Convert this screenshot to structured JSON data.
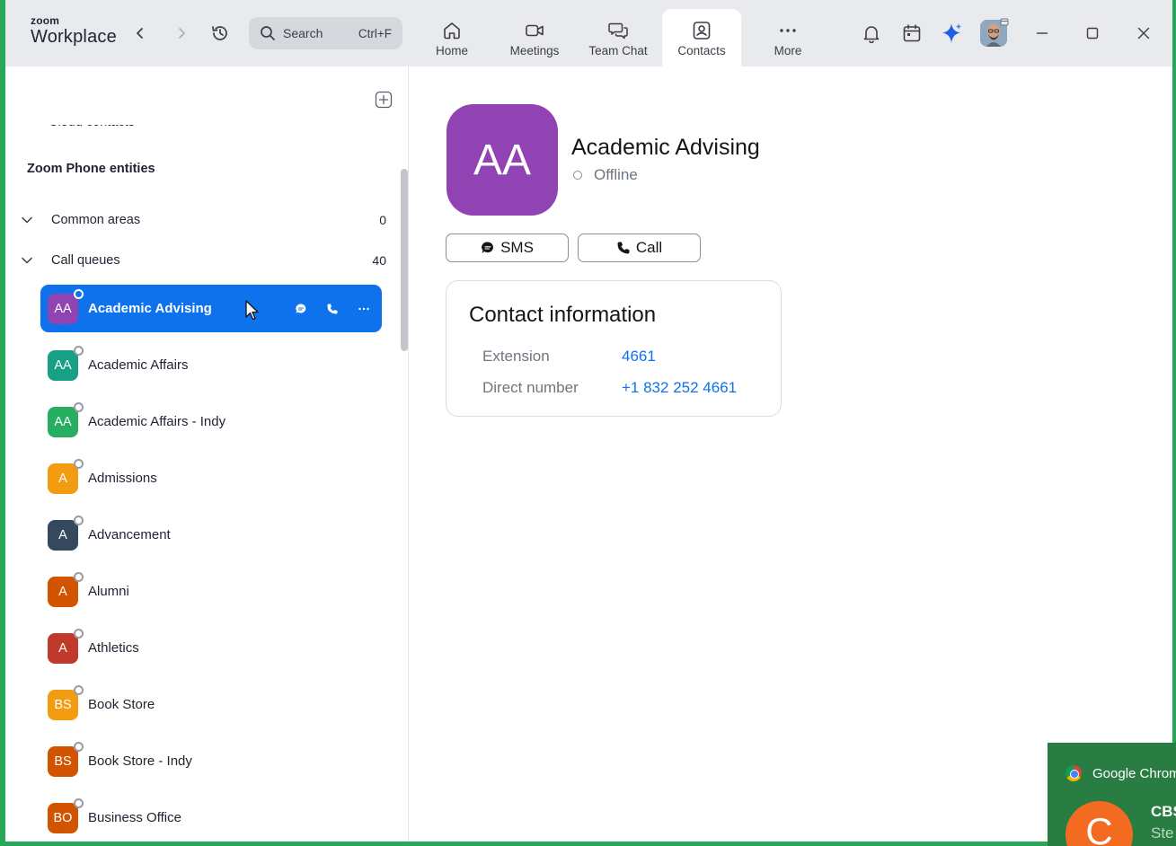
{
  "app": {
    "logo_line1": "zoom",
    "logo_line2": "Workplace"
  },
  "search": {
    "placeholder": "Search",
    "shortcut": "Ctrl+F"
  },
  "nav_tabs": [
    {
      "label": "Home",
      "icon": "home-icon"
    },
    {
      "label": "Meetings",
      "icon": "video-camera-icon"
    },
    {
      "label": "Team Chat",
      "icon": "chat-bubbles-icon"
    },
    {
      "label": "Contacts",
      "icon": "contacts-icon",
      "active": true
    },
    {
      "label": "More",
      "icon": "ellipsis-icon"
    }
  ],
  "sidebar": {
    "cut_row_label": "Cloud contacts",
    "cut_row_count": "-",
    "section_title": "Zoom Phone entities",
    "groups": [
      {
        "label": "Common areas",
        "count": "0"
      },
      {
        "label": "Call queues",
        "count": "40"
      }
    ],
    "items": [
      {
        "initials": "AA",
        "name": "Academic Advising",
        "color": "#9142b3",
        "selected": true
      },
      {
        "initials": "AA",
        "name": "Academic Affairs",
        "color": "#17a085"
      },
      {
        "initials": "AA",
        "name": "Academic Affairs - Indy",
        "color": "#27ae60"
      },
      {
        "initials": "A",
        "name": "Admissions",
        "color": "#f39c12"
      },
      {
        "initials": "A",
        "name": "Advancement",
        "color": "#34495e"
      },
      {
        "initials": "A",
        "name": "Alumni",
        "color": "#d35400"
      },
      {
        "initials": "A",
        "name": "Athletics",
        "color": "#c0392b"
      },
      {
        "initials": "BS",
        "name": "Book Store",
        "color": "#f39c12"
      },
      {
        "initials": "BS",
        "name": "Book Store - Indy",
        "color": "#d35400"
      },
      {
        "initials": "BO",
        "name": "Business Office",
        "color": "#d35400"
      }
    ]
  },
  "detail": {
    "initials": "AA",
    "name": "Academic Advising",
    "status": "Offline",
    "sms_label": "SMS",
    "call_label": "Call",
    "card_title": "Contact information",
    "extension_label": "Extension",
    "extension_value": "4661",
    "direct_label": "Direct number",
    "direct_value": "+1 832 252 4661"
  },
  "toast": {
    "app": "Google Chrom",
    "initial": "C",
    "title": "CBS",
    "subtitle": "Ste"
  },
  "colors": {
    "accent": "#0e72ed",
    "titlebar": "#e9eaee",
    "desktop": "#27a857"
  }
}
